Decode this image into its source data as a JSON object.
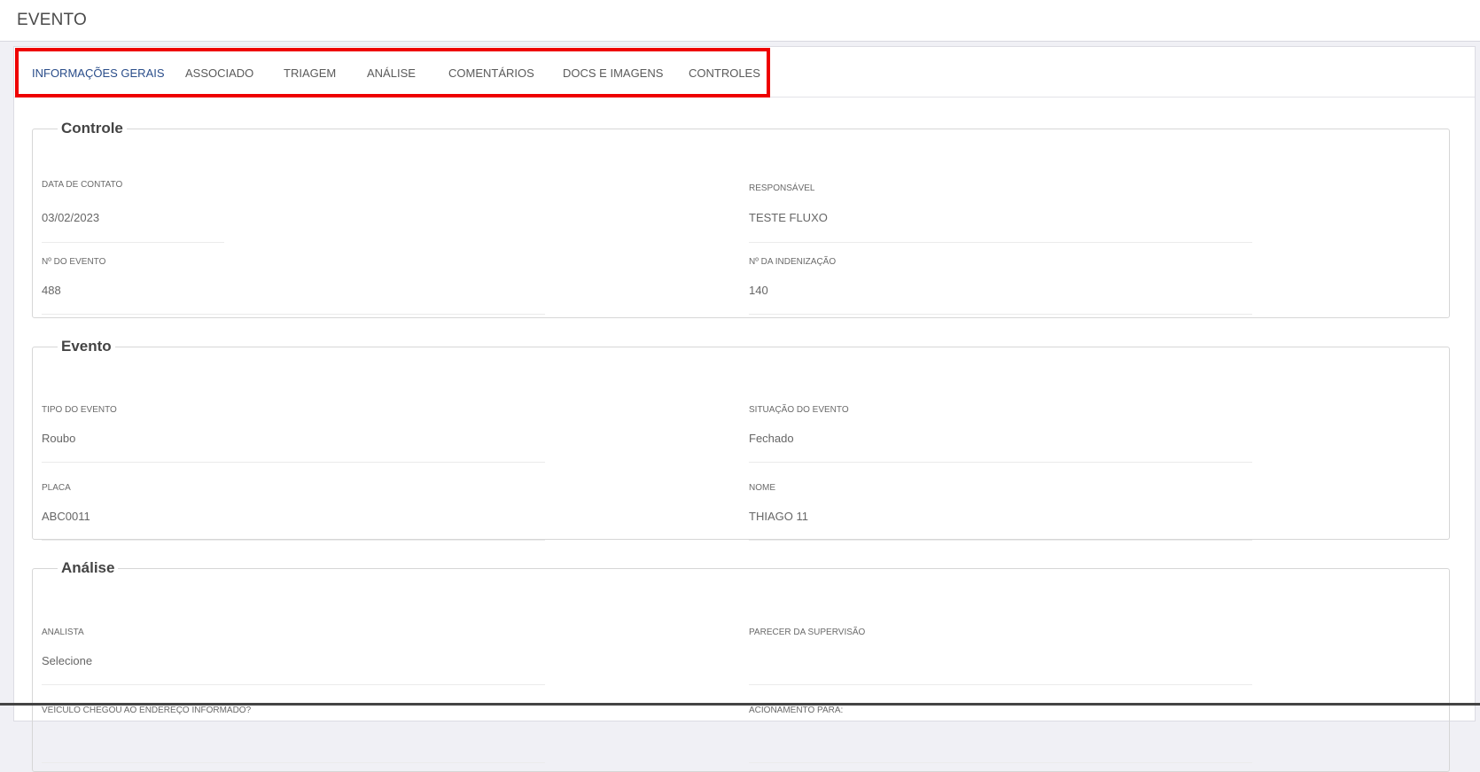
{
  "header": {
    "title": "EVENTO"
  },
  "tabs": [
    {
      "label": "INFORMAÇÕES GERAIS",
      "active": true
    },
    {
      "label": "ASSOCIADO"
    },
    {
      "label": "TRIAGEM"
    },
    {
      "label": "ANÁLISE"
    },
    {
      "label": "COMENTÁRIOS"
    },
    {
      "label": "DOCS E IMAGENS"
    },
    {
      "label": "CONTROLES"
    }
  ],
  "sections": {
    "controle": {
      "title": "Controle",
      "data_contato": {
        "label": "DATA DE CONTATO",
        "value": "03/02/2023"
      },
      "responsavel": {
        "label": "RESPONSÁVEL",
        "value": "TESTE FLUXO"
      },
      "num_evento": {
        "label": "Nº DO EVENTO",
        "value": "488"
      },
      "num_indenizacao": {
        "label": "Nº DA INDENIZAÇÃO",
        "value": "140"
      }
    },
    "evento": {
      "title": "Evento",
      "tipo": {
        "label": "TIPO DO EVENTO",
        "value": "Roubo"
      },
      "situacao": {
        "label": "SITUAÇÃO DO EVENTO",
        "value": "Fechado"
      },
      "placa": {
        "label": "PLACA",
        "value": "ABC0011"
      },
      "nome": {
        "label": "NOME",
        "value": "THIAGO 11"
      }
    },
    "analise": {
      "title": "Análise",
      "analista": {
        "label": "ANALISTA",
        "value": "Selecione"
      },
      "parecer": {
        "label": "PARECER DA SUPERVISÃO",
        "value": ""
      },
      "veiculo_chegou": {
        "label": "VEÍCULO CHEGOU AO ENDEREÇO INFORMADO?",
        "value": ""
      },
      "acionamento": {
        "label": "ACIONAMENTO PARA:",
        "value": ""
      }
    }
  },
  "colors": {
    "active_tab": "#2a4d8a",
    "highlight_border": "#ee0000"
  }
}
